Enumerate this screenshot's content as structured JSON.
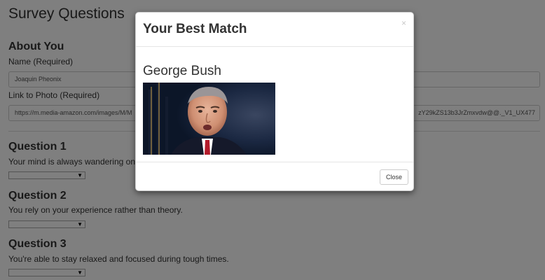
{
  "page": {
    "title": "Survey Questions"
  },
  "about": {
    "heading": "About You",
    "name_label": "Name (Required)",
    "name_value": "Joaquin Pheonix",
    "photo_label": "Link to Photo (Required)",
    "photo_value_start": "https://m.media-amazon.com/images/M/M",
    "photo_value_end": "zY29kZS13b3JrZmxvdw@@._V1_UX477"
  },
  "questions": [
    {
      "heading": "Question 1",
      "text": "Your mind is always wandering on",
      "selected": ""
    },
    {
      "heading": "Question 2",
      "text": "You rely on your experience rather than theory.",
      "selected": ""
    },
    {
      "heading": "Question 3",
      "text": "You're able to stay relaxed and focused during tough times.",
      "selected": ""
    }
  ],
  "modal": {
    "title": "Your Best Match",
    "close_x": "×",
    "match_name": "George Bush",
    "close_button": "Close"
  },
  "colors": {
    "backdrop": "rgba(0,0,0,0.5)",
    "text": "#333333",
    "border": "#cccccc"
  },
  "icons": {
    "close": "close-icon",
    "dropdown": "chevron-down-icon"
  }
}
